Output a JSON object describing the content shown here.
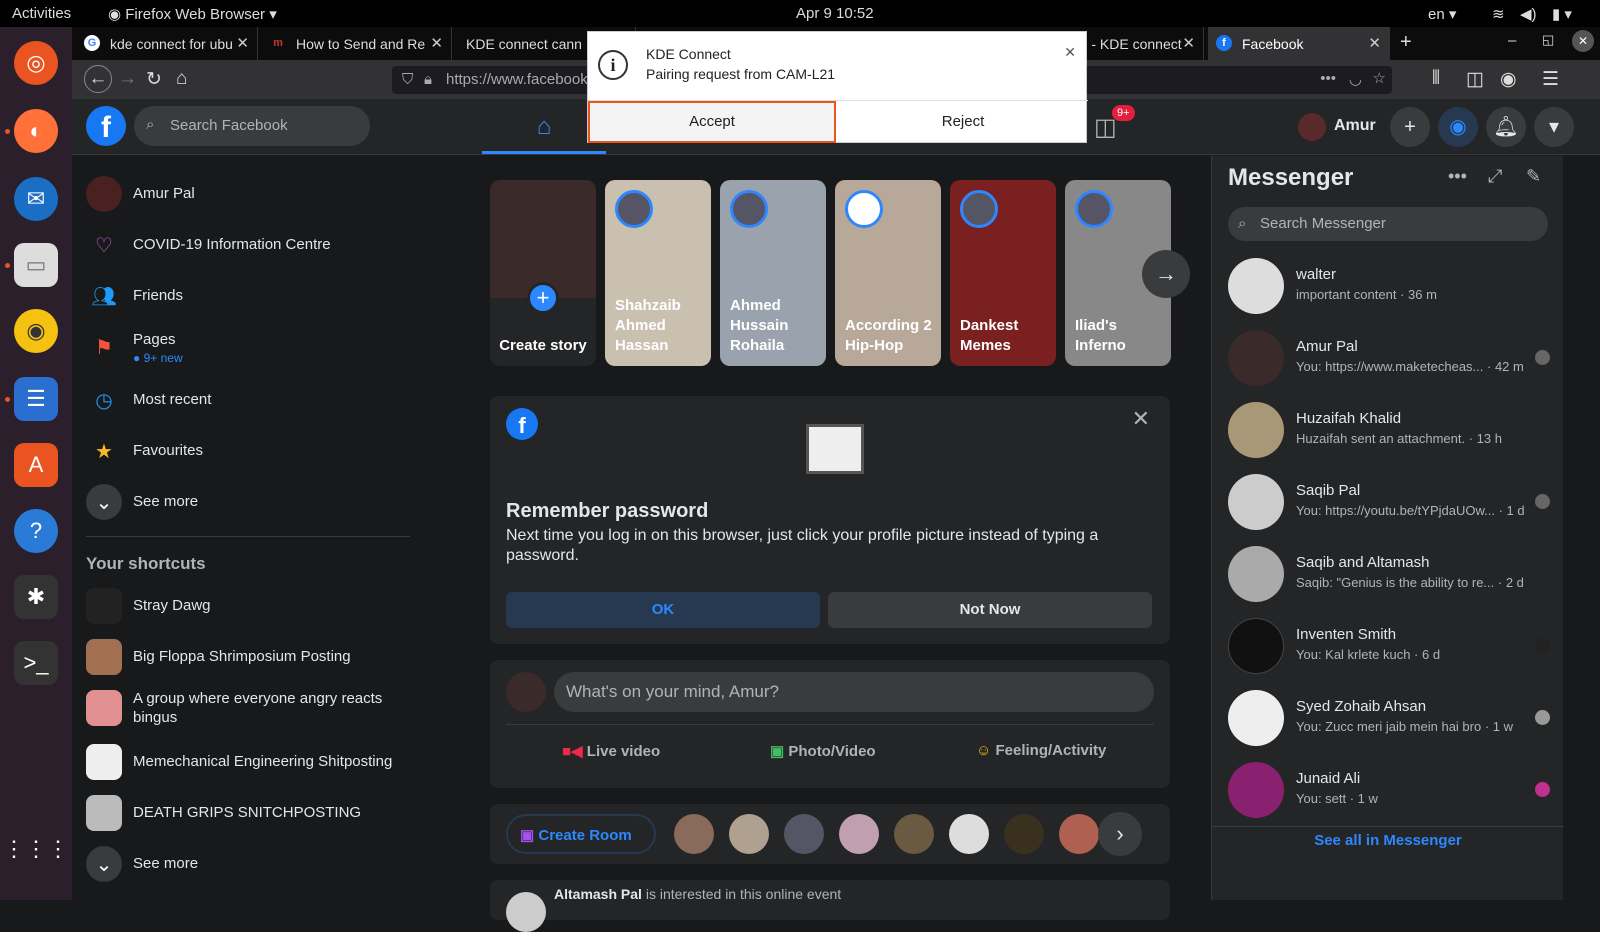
{
  "system": {
    "activities": "Activities",
    "app_name": "Firefox Web Browser",
    "clock": "Apr 9  10:52",
    "language": "en"
  },
  "browser": {
    "tabs": [
      {
        "label": "kde connect for ubu"
      },
      {
        "label": "How to Send and Re"
      },
      {
        "label": "KDE connect cann"
      },
      {
        "label": ".04 - KDE connect"
      },
      {
        "label": "Facebook"
      }
    ],
    "url": "https://www.facebook.com"
  },
  "notification": {
    "app": "KDE Connect",
    "message": "Pairing request from CAM-L21",
    "accept": "Accept",
    "reject": "Reject"
  },
  "fb_header": {
    "search_placeholder": "Search Facebook",
    "user": "Amur",
    "notif_badge": "9+"
  },
  "left_nav": {
    "items": [
      {
        "label": "Amur Pal"
      },
      {
        "label": "COVID-19 Information Centre"
      },
      {
        "label": "Friends"
      },
      {
        "label": "Pages",
        "sub": "● 9+ new"
      },
      {
        "label": "Most recent"
      },
      {
        "label": "Favourites"
      },
      {
        "label": "See more"
      }
    ],
    "shortcuts_title": "Your shortcuts",
    "shortcuts": [
      {
        "label": "Stray Dawg"
      },
      {
        "label": "Big Floppa Shrimposium Posting"
      },
      {
        "label": "A group where everyone angry reacts bingus"
      },
      {
        "label": "Memechanical Engineering Shitposting"
      },
      {
        "label": "DEATH GRIPS SNITCHPOSTING"
      },
      {
        "label": "See more"
      }
    ]
  },
  "stories": [
    {
      "name": "Create story",
      "color": "#3a2a2a"
    },
    {
      "name": "Shahzaib Ahmed Hassan",
      "color": "#c9c0b0"
    },
    {
      "name": "Ahmed Hussain Rohaila",
      "color": "#9aa3ad"
    },
    {
      "name": "According 2 Hip-Hop",
      "color": "#b8a89a"
    },
    {
      "name": "Dankest Memes",
      "color": "#7a2020"
    },
    {
      "name": "Iliad's Inferno",
      "color": "#888888"
    }
  ],
  "remember": {
    "title": "Remember password",
    "text": "Next time you log in on this browser, just click your profile picture instead of typing a password.",
    "ok": "OK",
    "not_now": "Not Now"
  },
  "composer": {
    "placeholder": "What's on your mind, Amur?",
    "live": "Live video",
    "photo": "Photo/Video",
    "feeling": "Feeling/Activity"
  },
  "rooms": {
    "create": "Create Room"
  },
  "post_preview": {
    "author": "Altamash Pal",
    "text": "is interested in this online event"
  },
  "messenger": {
    "title": "Messenger",
    "search_placeholder": "Search Messenger",
    "chats": [
      {
        "name": "walter",
        "msg": "important content · 36 m",
        "color": "#dddddd"
      },
      {
        "name": "Amur Pal",
        "msg": "You: https://www.maketecheas... · 42 m",
        "color": "#3a2a2a"
      },
      {
        "name": "Huzaifah Khalid",
        "msg": "Huzaifah sent an attachment. · 13 h",
        "color": "#a89878"
      },
      {
        "name": "Saqib Pal",
        "msg": "You: https://youtu.be/tYPjdaUOw... · 1 d",
        "color": "#cccccc"
      },
      {
        "name": "Saqib and Altamash",
        "msg": "Saqib: \"Genius is the ability to re... · 2 d",
        "color": "#aaaaaa"
      },
      {
        "name": "Inventen Smith",
        "msg": "You: Kal krlete kuch · 6 d",
        "color": "#111111"
      },
      {
        "name": "Syed Zohaib Ahsan",
        "msg": "You: Zucc meri jaib mein hai bro · 1 w",
        "color": "#eeeeee"
      },
      {
        "name": "Junaid Ali",
        "msg": "You: sett · 1 w",
        "color": "#8a2070"
      }
    ],
    "see_all": "See all in Messenger"
  }
}
